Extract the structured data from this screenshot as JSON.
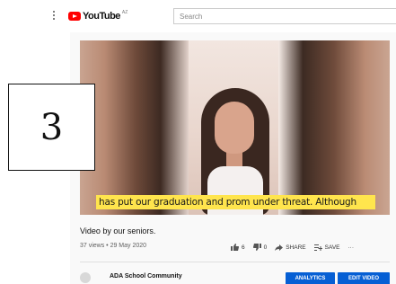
{
  "header": {
    "logo_text": "YouTube",
    "country_code": "AZ",
    "search_placeholder": "Search"
  },
  "video": {
    "subtitle": "has put our graduation and prom under threat. Although",
    "overlay_number": "3"
  },
  "details": {
    "title": "Video by our seniors.",
    "meta": "37 views • 29 May 2020",
    "likes": "6",
    "dislikes": "0",
    "share_label": "SHARE",
    "save_label": "SAVE",
    "more_label": "···"
  },
  "channel": {
    "name": "ADA School Community",
    "analytics_label": "ANALYTICS",
    "edit_label": "EDIT VIDEO"
  },
  "colors": {
    "brand_red": "#ff0000",
    "action_blue": "#065fd4",
    "subtitle_bg": "#ffe54d"
  }
}
